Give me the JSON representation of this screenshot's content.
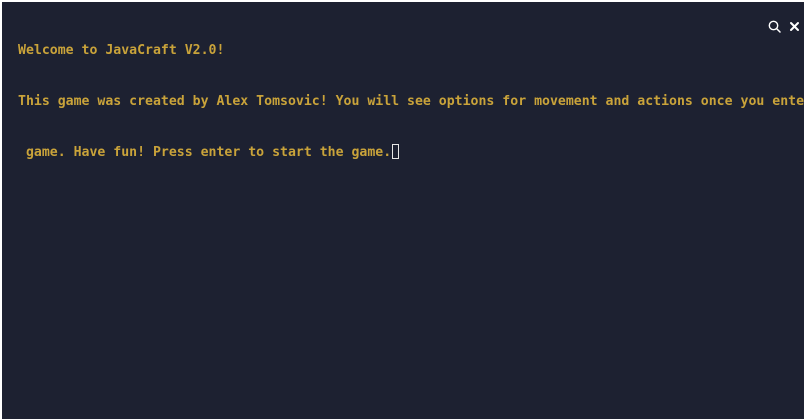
{
  "terminal": {
    "lines": [
      "Welcome to JavaCraft V2.0!",
      "This game was created by Alex Tomsovic! You will see options for movement and actions once you enter the",
      " game. Have fun! Press enter to start the game."
    ],
    "text_color": "#c9a33a",
    "background_color": "#1d2131"
  },
  "toolbar": {
    "search_icon": "search-icon",
    "close_icon": "close-icon"
  }
}
